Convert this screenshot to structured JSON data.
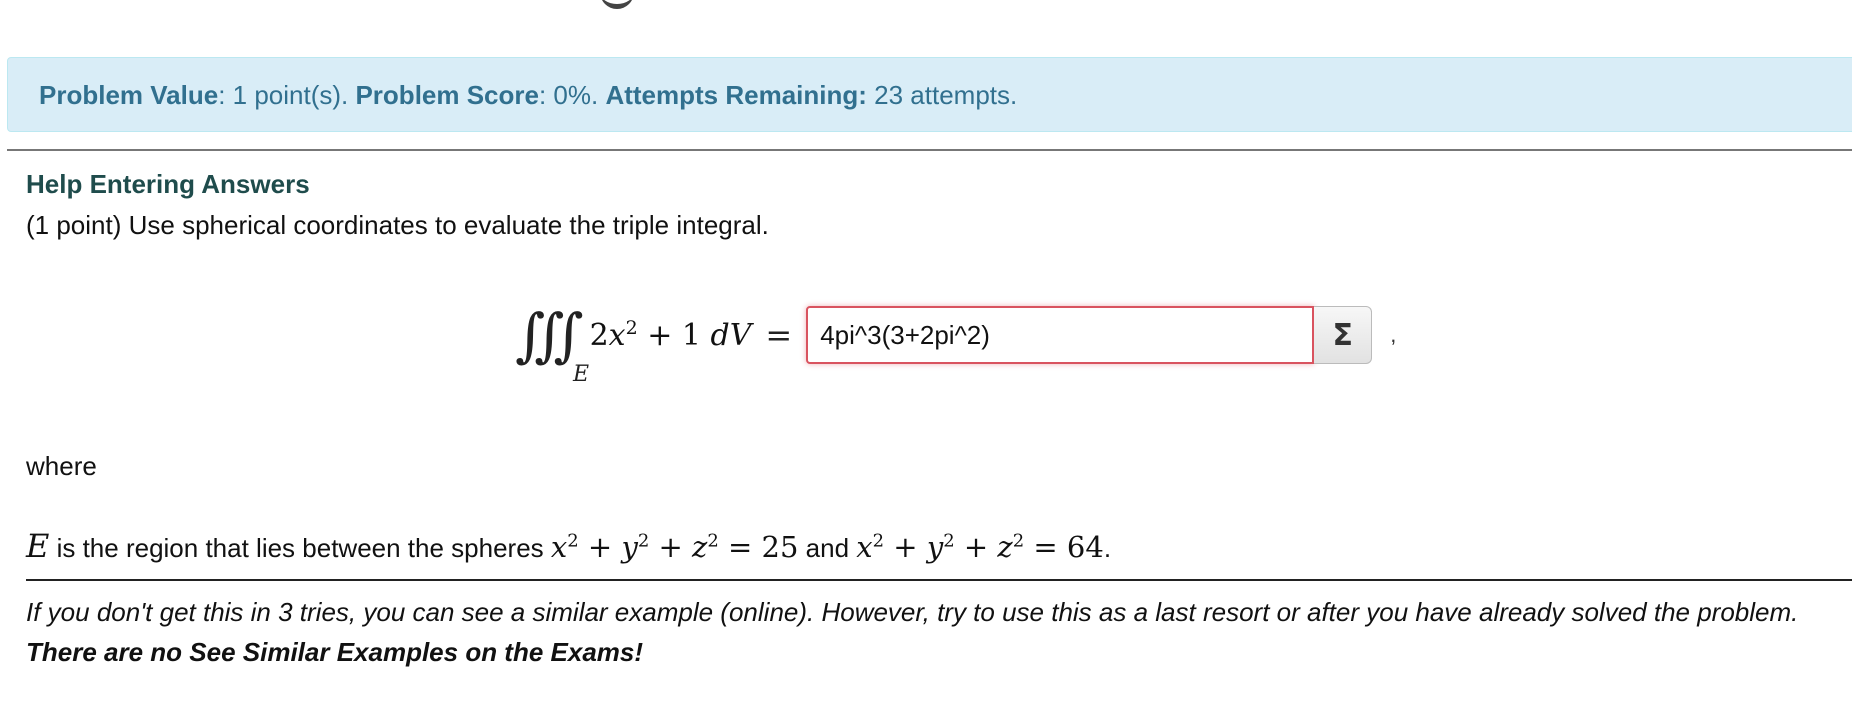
{
  "status_bar": {
    "value_label": "Problem Value",
    "value_text": ": 1 point(s). ",
    "score_label": "Problem Score",
    "score_text": ": 0%. ",
    "attempts_label": "Attempts Remaining:",
    "attempts_text": " 23 attempts."
  },
  "help_link": "Help Entering Answers",
  "problem": {
    "intro": "(1 point) Use spherical coordinates to evaluate the triple integral.",
    "integral_symbol": "∭",
    "integral_region": "E",
    "integrand_coef": "2",
    "integrand_var": "x",
    "integrand_exp": "2",
    "integrand_rest": " + 1 ",
    "integrand_d": "dV",
    "equals": "=",
    "answer_value": "4pi^3(3+2pi^2)",
    "sigma_label": "Σ",
    "trailing_comma": ",",
    "where": "where",
    "region_symbol": "E",
    "region_text_1": " is the region that lies between the spheres ",
    "sphere1": {
      "x": "x",
      "y": "y",
      "z": "z",
      "exp": "2",
      "rhs": "25"
    },
    "region_text_and": " and ",
    "sphere2": {
      "x": "x",
      "y": "y",
      "z": "z",
      "exp": "2",
      "rhs": "64"
    },
    "region_text_end": "."
  },
  "footnote": {
    "italic_text": "If you don't get this in 3 tries, you can see a similar example (online). However, try to use this as a last resort or after you have already solved the problem. ",
    "bold_text": "There are no See Similar Examples on the Exams!"
  },
  "colors": {
    "alert_bg": "#d9edf7",
    "alert_text": "#31708f",
    "input_error_border": "#d9535f",
    "help_link": "#1f4c4c"
  }
}
